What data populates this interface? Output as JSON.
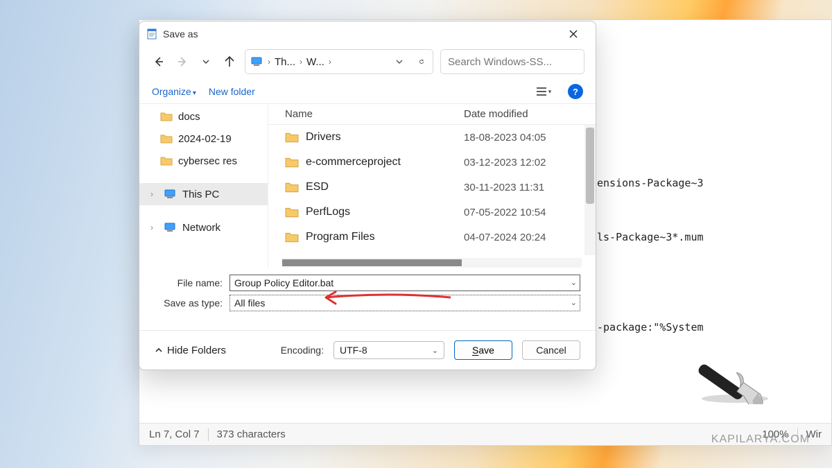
{
  "dialog": {
    "title": "Save as",
    "breadcrumb": {
      "seg1": "Th...",
      "seg2": "W..."
    },
    "search_placeholder": "Search Windows-SS...",
    "organize": "Organize",
    "new_folder": "New folder",
    "columns": {
      "name": "Name",
      "date": "Date modified"
    },
    "sidebar": {
      "items": [
        {
          "label": "docs"
        },
        {
          "label": "2024-02-19"
        },
        {
          "label": "cybersec res"
        }
      ],
      "roots": [
        {
          "label": "This PC"
        },
        {
          "label": "Network"
        }
      ]
    },
    "files": [
      {
        "name": "Drivers",
        "date": "18-08-2023 04:05"
      },
      {
        "name": "e-commerceproject",
        "date": "03-12-2023 12:02"
      },
      {
        "name": "ESD",
        "date": "30-11-2023 11:31"
      },
      {
        "name": "PerfLogs",
        "date": "07-05-2022 10:54"
      },
      {
        "name": "Program Files",
        "date": "04-07-2024 20:24"
      }
    ],
    "filename_label": "File name:",
    "filename_value": "Group Policy Editor.bat",
    "type_label": "Save as type:",
    "type_value": "All files",
    "hide_folders": "Hide Folders",
    "encoding_label": "Encoding:",
    "encoding_value": "UTF-8",
    "save": "Save",
    "cancel": "Cancel"
  },
  "notepad": {
    "lines": [
      "ensions-Package~3",
      "ls-Package~3*.mum",
      "",
      "-package:\"%System"
    ]
  },
  "statusbar": {
    "pos": "Ln 7, Col 7",
    "chars": "373 characters",
    "zoom": "100%",
    "platform": "Wir"
  },
  "watermark": "KAPILARYA.COM"
}
